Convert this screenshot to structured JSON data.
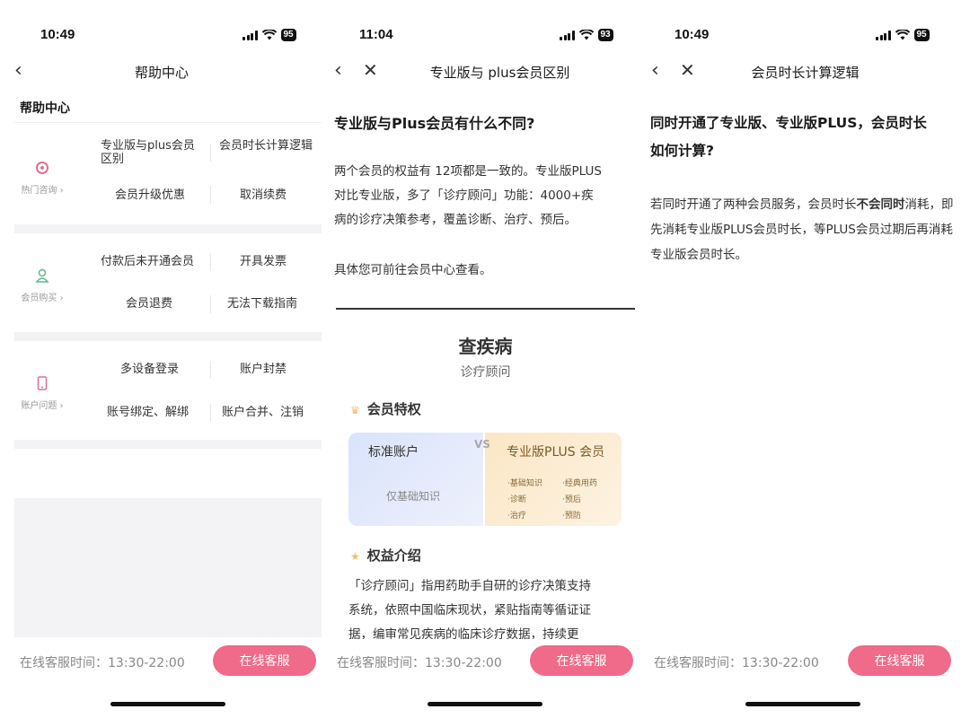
{
  "screen1": {
    "time": "10:49",
    "battery": "95",
    "nav_title": "帮助中心",
    "page_heading": "帮助中心",
    "sections": [
      {
        "label": "热门咨询",
        "icon": "hot-icon",
        "items": [
          "专业版与plus会员区别",
          "会员时长计算逻辑",
          "会员升级优惠",
          "取消续费"
        ]
      },
      {
        "label": "会员购买",
        "icon": "user-icon",
        "items": [
          "付款后未开通会员",
          "开具发票",
          "会员退费",
          "无法下载指南"
        ]
      },
      {
        "label": "账户问题",
        "icon": "phone-icon",
        "items": [
          "多设备登录",
          "账户封禁",
          "账号绑定、解绑",
          "账户合并、注销"
        ]
      }
    ],
    "service_hours": "在线客服时间：13:30-22:00",
    "service_button": "在线客服"
  },
  "screen2": {
    "time": "11:04",
    "battery": "93",
    "nav_title": "专业版与 plus会员区别",
    "question": "专业版与Plus会员有什么不同?",
    "para1": [
      "两个会员的权益有 12项都是一致的。专业版PLUS",
      "对比专业版，多了「诊疗顾问」功能：4000+疾",
      "病的诊疗决策参考，覆盖诊断、治疗、预后。"
    ],
    "para2": "具体您可前往会员中心查看。",
    "card": {
      "title": "查疾病",
      "subtitle": "诊疗顾问",
      "privilege_heading": "会员特权",
      "left_title": "标准账户",
      "left_sub": "仅基础知识",
      "vs": "VS",
      "right_title": "专业版PLUS 会员",
      "features": [
        "·基础知识",
        "·经典用药",
        "·诊断",
        "·预后",
        "·治疗",
        "·预防"
      ],
      "intro_heading": "权益介绍",
      "intro_lines": [
        "「诊疗顾问」指用药助手自研的诊疗决策支持",
        "系统，依照中国临床现状，紧贴指南等循证证",
        "据，编审常见疾病的临床诊疗数据，持续更"
      ]
    },
    "service_hours": "在线客服时间：13:30-22:00",
    "service_button": "在线客服"
  },
  "screen3": {
    "time": "10:49",
    "battery": "95",
    "nav_title": "会员时长计算逻辑",
    "question_line1": "同时开通了专业版、专业版PLUS，会员时长",
    "question_line2": "如何计算?",
    "answer_pre": "若同时开通了两种会员服务，会员时长",
    "answer_bold": "不会同时",
    "answer_post": "消耗，即先消耗专业版PLUS会员时长，等PLUS会员过期后再消耗专业版会员时长。",
    "service_hours": "在线客服时间：13:30-22:00",
    "service_button": "在线客服"
  },
  "colors": {
    "accent": "#f06a8a",
    "icon_pink": "#e0708f",
    "icon_green": "#5cb88a",
    "icon_pink2": "#e07090"
  }
}
